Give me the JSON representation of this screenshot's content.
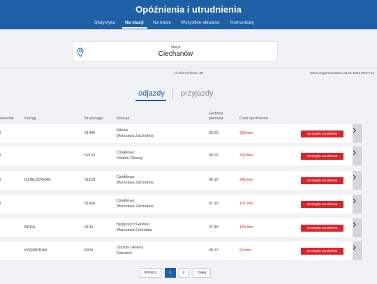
{
  "header": {
    "title": "Opóźnienia i utrudnienia",
    "nav": [
      "Statystyka",
      "Na stacji",
      "Na trasie",
      "Wszystkie aktualne",
      "Komunikaty"
    ],
    "active_nav": "Na stacji"
  },
  "station": {
    "label": "Stacja",
    "value": "Ciechanów"
  },
  "results": {
    "label": "Liczba wyników:",
    "count": "10"
  },
  "generated": "Dane wygenerowano: 04.01.2024 09:57:12",
  "toggle": {
    "departures": "odjazdy",
    "arrivals": "przyjazdy",
    "active": "odjazdy"
  },
  "columns": {
    "carrier": "ewoźnik",
    "train": "Pociąg",
    "train_no": "Nr pociągu",
    "relation": "Relacja",
    "planned": [
      "Godzina",
      "planowa"
    ],
    "delay": "Czas opóźnienia"
  },
  "details_label": "szczegóły utrudnienia",
  "rows": [
    {
      "carrier": "I",
      "train": "",
      "train_no": "51400",
      "relation": [
        "Mława",
        "Warszawa Zachodnia"
      ],
      "planned": "03:22",
      "delay": "393 min"
    },
    {
      "carrier": "I",
      "train": "",
      "train_no": "52120",
      "relation": [
        "Działdowo",
        "Radom Główny"
      ],
      "planned": "05:03",
      "delay": "332 min"
    },
    {
      "carrier": "I",
      "train": "DZIAŁDOWIAK",
      "train_no": "51128",
      "relation": [
        "Działdowo",
        "Warszawa Zachodnia"
      ],
      "planned": "06:16",
      "delay": "245 min"
    },
    {
      "carrier": "I",
      "train": "",
      "train_no": "51424",
      "relation": [
        "Działdowo",
        "Warszawa Zachodnia"
      ],
      "planned": "07:15",
      "delay": "197 min"
    },
    {
      "carrier": "",
      "train": "BRDA",
      "train_no": "5130",
      "relation": [
        "Bydgoszcz Główna",
        "Warszawa Centralna"
      ],
      "planned": "07:48",
      "delay": "183 min"
    },
    {
      "carrier": "",
      "train": "KORMORAN",
      "train_no": "5424",
      "relation": [
        "Olsztyn Główny",
        "Katowice"
      ],
      "planned": "09:12",
      "delay": "54 min"
    }
  ],
  "pagination": {
    "prev": "Wstecz",
    "pages": [
      "1",
      "2"
    ],
    "active_page": "1",
    "next": "Dalej"
  },
  "colors": {
    "primary": "#1f5fa5",
    "danger": "#d8262b",
    "background": "#f1f2f5"
  }
}
